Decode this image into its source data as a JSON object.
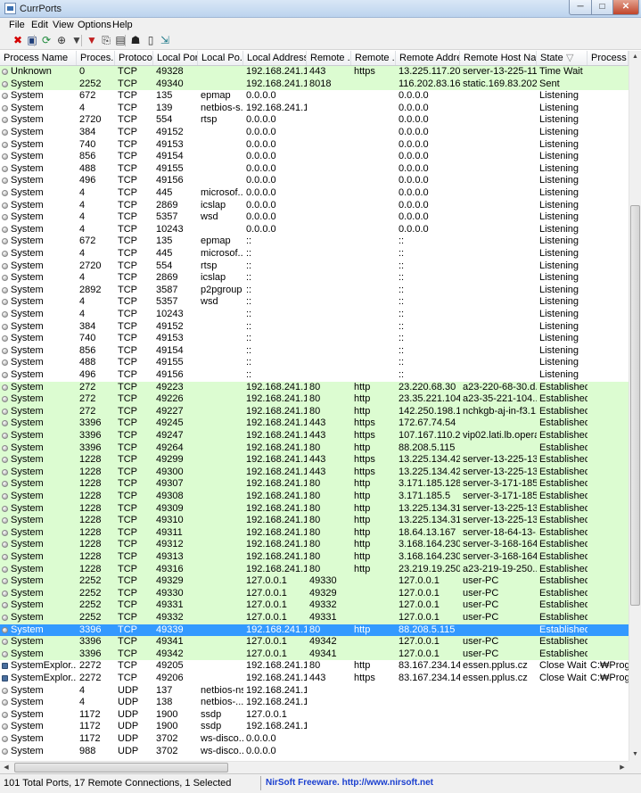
{
  "window": {
    "title": "CurrPorts",
    "min": "─",
    "max": "□",
    "close": "✕"
  },
  "menu": [
    "File",
    "Edit",
    "View",
    "Options",
    "Help"
  ],
  "toolbar": [
    {
      "name": "delete-icon",
      "glyph": "✖",
      "color": "#d40000"
    },
    {
      "name": "save-icon",
      "glyph": "▣",
      "color": "#1f3e7a"
    },
    {
      "name": "refresh-icon",
      "glyph": "⟳",
      "color": "#1f8a3c"
    },
    {
      "name": "properties-icon",
      "glyph": "⊕",
      "color": "#333333"
    },
    {
      "name": "filter-icon",
      "glyph": "▼",
      "color": "#444444"
    },
    {
      "name": "filter-off-icon",
      "glyph": "▼",
      "color": "#c02020"
    },
    {
      "name": "copy-icon",
      "glyph": "⎘",
      "color": "#333333"
    },
    {
      "name": "html-report-icon",
      "glyph": "▤",
      "color": "#333333"
    },
    {
      "name": "find-icon",
      "glyph": "☗",
      "color": "#222222"
    },
    {
      "name": "report-icon",
      "glyph": "▯",
      "color": "#333333"
    },
    {
      "name": "exit-icon",
      "glyph": "⇲",
      "color": "#1f7a8a"
    }
  ],
  "columns": [
    "Process Name",
    "Proces...",
    "Protocol",
    "Local Port",
    "Local Po...",
    "Local Address",
    "Remote ...",
    "Remote ...",
    "Remote Address",
    "Remote Host Name",
    "State",
    "Process P"
  ],
  "sort_indicator": "▽",
  "rows": [
    {
      "t": "g",
      "c": [
        "Unknown",
        "0",
        "TCP",
        "49328",
        "",
        "192.168.241.1...",
        "443",
        "https",
        "13.225.117.20",
        "server-13-225-11...",
        "Time Wait",
        ""
      ]
    },
    {
      "t": "g",
      "c": [
        "System",
        "2252",
        "TCP",
        "49340",
        "",
        "192.168.241.1...",
        "8018",
        "",
        "116.202.83.169",
        "static.169.83.202...",
        "Sent",
        ""
      ]
    },
    {
      "t": "w",
      "c": [
        "System",
        "672",
        "TCP",
        "135",
        "epmap",
        "0.0.0.0",
        "",
        "",
        "0.0.0.0",
        "",
        "Listening",
        ""
      ]
    },
    {
      "t": "w",
      "c": [
        "System",
        "4",
        "TCP",
        "139",
        "netbios-s...",
        "192.168.241.1...",
        "",
        "",
        "0.0.0.0",
        "",
        "Listening",
        ""
      ]
    },
    {
      "t": "w",
      "c": [
        "System",
        "2720",
        "TCP",
        "554",
        "rtsp",
        "0.0.0.0",
        "",
        "",
        "0.0.0.0",
        "",
        "Listening",
        ""
      ]
    },
    {
      "t": "w",
      "c": [
        "System",
        "384",
        "TCP",
        "49152",
        "",
        "0.0.0.0",
        "",
        "",
        "0.0.0.0",
        "",
        "Listening",
        ""
      ]
    },
    {
      "t": "w",
      "c": [
        "System",
        "740",
        "TCP",
        "49153",
        "",
        "0.0.0.0",
        "",
        "",
        "0.0.0.0",
        "",
        "Listening",
        ""
      ]
    },
    {
      "t": "w",
      "c": [
        "System",
        "856",
        "TCP",
        "49154",
        "",
        "0.0.0.0",
        "",
        "",
        "0.0.0.0",
        "",
        "Listening",
        ""
      ]
    },
    {
      "t": "w",
      "c": [
        "System",
        "488",
        "TCP",
        "49155",
        "",
        "0.0.0.0",
        "",
        "",
        "0.0.0.0",
        "",
        "Listening",
        ""
      ]
    },
    {
      "t": "w",
      "c": [
        "System",
        "496",
        "TCP",
        "49156",
        "",
        "0.0.0.0",
        "",
        "",
        "0.0.0.0",
        "",
        "Listening",
        ""
      ]
    },
    {
      "t": "w",
      "c": [
        "System",
        "4",
        "TCP",
        "445",
        "microsof...",
        "0.0.0.0",
        "",
        "",
        "0.0.0.0",
        "",
        "Listening",
        ""
      ]
    },
    {
      "t": "w",
      "c": [
        "System",
        "4",
        "TCP",
        "2869",
        "icslap",
        "0.0.0.0",
        "",
        "",
        "0.0.0.0",
        "",
        "Listening",
        ""
      ]
    },
    {
      "t": "w",
      "c": [
        "System",
        "4",
        "TCP",
        "5357",
        "wsd",
        "0.0.0.0",
        "",
        "",
        "0.0.0.0",
        "",
        "Listening",
        ""
      ]
    },
    {
      "t": "w",
      "c": [
        "System",
        "4",
        "TCP",
        "10243",
        "",
        "0.0.0.0",
        "",
        "",
        "0.0.0.0",
        "",
        "Listening",
        ""
      ]
    },
    {
      "t": "w",
      "c": [
        "System",
        "672",
        "TCP",
        "135",
        "epmap",
        "::",
        "",
        "",
        "::",
        "",
        "Listening",
        ""
      ]
    },
    {
      "t": "w",
      "c": [
        "System",
        "4",
        "TCP",
        "445",
        "microsof...",
        "::",
        "",
        "",
        "::",
        "",
        "Listening",
        ""
      ]
    },
    {
      "t": "w",
      "c": [
        "System",
        "2720",
        "TCP",
        "554",
        "rtsp",
        "::",
        "",
        "",
        "::",
        "",
        "Listening",
        ""
      ]
    },
    {
      "t": "w",
      "c": [
        "System",
        "4",
        "TCP",
        "2869",
        "icslap",
        "::",
        "",
        "",
        "::",
        "",
        "Listening",
        ""
      ]
    },
    {
      "t": "w",
      "c": [
        "System",
        "2892",
        "TCP",
        "3587",
        "p2pgroup",
        "::",
        "",
        "",
        "::",
        "",
        "Listening",
        ""
      ]
    },
    {
      "t": "w",
      "c": [
        "System",
        "4",
        "TCP",
        "5357",
        "wsd",
        "::",
        "",
        "",
        "::",
        "",
        "Listening",
        ""
      ]
    },
    {
      "t": "w",
      "c": [
        "System",
        "4",
        "TCP",
        "10243",
        "",
        "::",
        "",
        "",
        "::",
        "",
        "Listening",
        ""
      ]
    },
    {
      "t": "w",
      "c": [
        "System",
        "384",
        "TCP",
        "49152",
        "",
        "::",
        "",
        "",
        "::",
        "",
        "Listening",
        ""
      ]
    },
    {
      "t": "w",
      "c": [
        "System",
        "740",
        "TCP",
        "49153",
        "",
        "::",
        "",
        "",
        "::",
        "",
        "Listening",
        ""
      ]
    },
    {
      "t": "w",
      "c": [
        "System",
        "856",
        "TCP",
        "49154",
        "",
        "::",
        "",
        "",
        "::",
        "",
        "Listening",
        ""
      ]
    },
    {
      "t": "w",
      "c": [
        "System",
        "488",
        "TCP",
        "49155",
        "",
        "::",
        "",
        "",
        "::",
        "",
        "Listening",
        ""
      ]
    },
    {
      "t": "w",
      "c": [
        "System",
        "496",
        "TCP",
        "49156",
        "",
        "::",
        "",
        "",
        "::",
        "",
        "Listening",
        ""
      ]
    },
    {
      "t": "g",
      "c": [
        "System",
        "272",
        "TCP",
        "49223",
        "",
        "192.168.241.1...",
        "80",
        "http",
        "23.220.68.30",
        "a23-220-68-30.d...",
        "Established",
        ""
      ]
    },
    {
      "t": "g",
      "c": [
        "System",
        "272",
        "TCP",
        "49226",
        "",
        "192.168.241.1...",
        "80",
        "http",
        "23.35.221.104",
        "a23-35-221-104....",
        "Established",
        ""
      ]
    },
    {
      "t": "g",
      "c": [
        "System",
        "272",
        "TCP",
        "49227",
        "",
        "192.168.241.1...",
        "80",
        "http",
        "142.250.198.1...",
        "nchkgb-aj-in-f3.1...",
        "Established",
        ""
      ]
    },
    {
      "t": "g",
      "c": [
        "System",
        "3396",
        "TCP",
        "49245",
        "",
        "192.168.241.1...",
        "443",
        "https",
        "172.67.74.54",
        "",
        "Established",
        ""
      ]
    },
    {
      "t": "g",
      "c": [
        "System",
        "3396",
        "TCP",
        "49247",
        "",
        "192.168.241.1...",
        "443",
        "https",
        "107.167.110.2...",
        "vip02.lati.lb.opera....",
        "Established",
        ""
      ]
    },
    {
      "t": "g",
      "c": [
        "System",
        "3396",
        "TCP",
        "49264",
        "",
        "192.168.241.1...",
        "80",
        "http",
        "88.208.5.115",
        "",
        "Established",
        ""
      ]
    },
    {
      "t": "g",
      "c": [
        "System",
        "1228",
        "TCP",
        "49299",
        "",
        "192.168.241.1...",
        "443",
        "https",
        "13.225.134.42",
        "server-13-225-13...",
        "Established",
        ""
      ]
    },
    {
      "t": "g",
      "c": [
        "System",
        "1228",
        "TCP",
        "49300",
        "",
        "192.168.241.1...",
        "443",
        "https",
        "13.225.134.42",
        "server-13-225-13...",
        "Established",
        ""
      ]
    },
    {
      "t": "g",
      "c": [
        "System",
        "1228",
        "TCP",
        "49307",
        "",
        "192.168.241.1...",
        "80",
        "http",
        "3.171.185.128",
        "server-3-171-185...",
        "Established",
        ""
      ]
    },
    {
      "t": "g",
      "c": [
        "System",
        "1228",
        "TCP",
        "49308",
        "",
        "192.168.241.1...",
        "80",
        "http",
        "3.171.185.5",
        "server-3-171-185...",
        "Established",
        ""
      ]
    },
    {
      "t": "g",
      "c": [
        "System",
        "1228",
        "TCP",
        "49309",
        "",
        "192.168.241.1...",
        "80",
        "http",
        "13.225.134.31",
        "server-13-225-13...",
        "Established",
        ""
      ]
    },
    {
      "t": "g",
      "c": [
        "System",
        "1228",
        "TCP",
        "49310",
        "",
        "192.168.241.1...",
        "80",
        "http",
        "13.225.134.31",
        "server-13-225-13...",
        "Established",
        ""
      ]
    },
    {
      "t": "g",
      "c": [
        "System",
        "1228",
        "TCP",
        "49311",
        "",
        "192.168.241.1...",
        "80",
        "http",
        "18.64.13.167",
        "server-18-64-13-...",
        "Established",
        ""
      ]
    },
    {
      "t": "g",
      "c": [
        "System",
        "1228",
        "TCP",
        "49312",
        "",
        "192.168.241.1...",
        "80",
        "http",
        "3.168.164.230",
        "server-3-168-164...",
        "Established",
        ""
      ]
    },
    {
      "t": "g",
      "c": [
        "System",
        "1228",
        "TCP",
        "49313",
        "",
        "192.168.241.1...",
        "80",
        "http",
        "3.168.164.230",
        "server-3-168-164...",
        "Established",
        ""
      ]
    },
    {
      "t": "g",
      "c": [
        "System",
        "1228",
        "TCP",
        "49316",
        "",
        "192.168.241.1...",
        "80",
        "http",
        "23.219.19.250",
        "a23-219-19-250....",
        "Established",
        ""
      ]
    },
    {
      "t": "g",
      "c": [
        "System",
        "2252",
        "TCP",
        "49329",
        "",
        "127.0.0.1",
        "49330",
        "",
        "127.0.0.1",
        "user-PC",
        "Established",
        ""
      ]
    },
    {
      "t": "g",
      "c": [
        "System",
        "2252",
        "TCP",
        "49330",
        "",
        "127.0.0.1",
        "49329",
        "",
        "127.0.0.1",
        "user-PC",
        "Established",
        ""
      ]
    },
    {
      "t": "g",
      "c": [
        "System",
        "2252",
        "TCP",
        "49331",
        "",
        "127.0.0.1",
        "49332",
        "",
        "127.0.0.1",
        "user-PC",
        "Established",
        ""
      ]
    },
    {
      "t": "g",
      "c": [
        "System",
        "2252",
        "TCP",
        "49332",
        "",
        "127.0.0.1",
        "49331",
        "",
        "127.0.0.1",
        "user-PC",
        "Established",
        ""
      ]
    },
    {
      "t": "s",
      "c": [
        "System",
        "3396",
        "TCP",
        "49339",
        "",
        "192.168.241.1...",
        "80",
        "http",
        "88.208.5.115",
        "",
        "Established",
        ""
      ]
    },
    {
      "t": "g",
      "c": [
        "System",
        "3396",
        "TCP",
        "49341",
        "",
        "127.0.0.1",
        "49342",
        "",
        "127.0.0.1",
        "user-PC",
        "Established",
        ""
      ]
    },
    {
      "t": "g",
      "c": [
        "System",
        "3396",
        "TCP",
        "49342",
        "",
        "127.0.0.1",
        "49341",
        "",
        "127.0.0.1",
        "user-PC",
        "Established",
        ""
      ]
    },
    {
      "t": "e",
      "c": [
        "SystemExplor...",
        "2272",
        "TCP",
        "49205",
        "",
        "192.168.241.1...",
        "80",
        "http",
        "83.167.234.14",
        "essen.pplus.cz",
        "Close Wait",
        "C:₩Progra"
      ]
    },
    {
      "t": "e",
      "c": [
        "SystemExplor...",
        "2272",
        "TCP",
        "49206",
        "",
        "192.168.241.1...",
        "443",
        "https",
        "83.167.234.14",
        "essen.pplus.cz",
        "Close Wait",
        "C:₩Progra"
      ]
    },
    {
      "t": "w",
      "c": [
        "System",
        "4",
        "UDP",
        "137",
        "netbios-ns",
        "192.168.241.1...",
        "",
        "",
        "",
        "",
        "",
        ""
      ]
    },
    {
      "t": "w",
      "c": [
        "System",
        "4",
        "UDP",
        "138",
        "netbios-...",
        "192.168.241.1...",
        "",
        "",
        "",
        "",
        "",
        ""
      ]
    },
    {
      "t": "w",
      "c": [
        "System",
        "1172",
        "UDP",
        "1900",
        "ssdp",
        "127.0.0.1",
        "",
        "",
        "",
        "",
        "",
        ""
      ]
    },
    {
      "t": "w",
      "c": [
        "System",
        "1172",
        "UDP",
        "1900",
        "ssdp",
        "192.168.241.1...",
        "",
        "",
        "",
        "",
        "",
        ""
      ]
    },
    {
      "t": "w",
      "c": [
        "System",
        "1172",
        "UDP",
        "3702",
        "ws-disco...",
        "0.0.0.0",
        "",
        "",
        "",
        "",
        "",
        ""
      ]
    },
    {
      "t": "w",
      "c": [
        "System",
        "988",
        "UDP",
        "3702",
        "ws-disco...",
        "0.0.0.0",
        "",
        "",
        "",
        "",
        "",
        ""
      ]
    }
  ],
  "status": {
    "summary": "101 Total Ports, 17 Remote Connections, 1 Selected",
    "link": "NirSoft Freeware.  http://www.nirsoft.net"
  },
  "colors": {
    "green_row": "#dcfcd1",
    "selected_row": "#3399ff",
    "link": "#1a3fcf"
  }
}
